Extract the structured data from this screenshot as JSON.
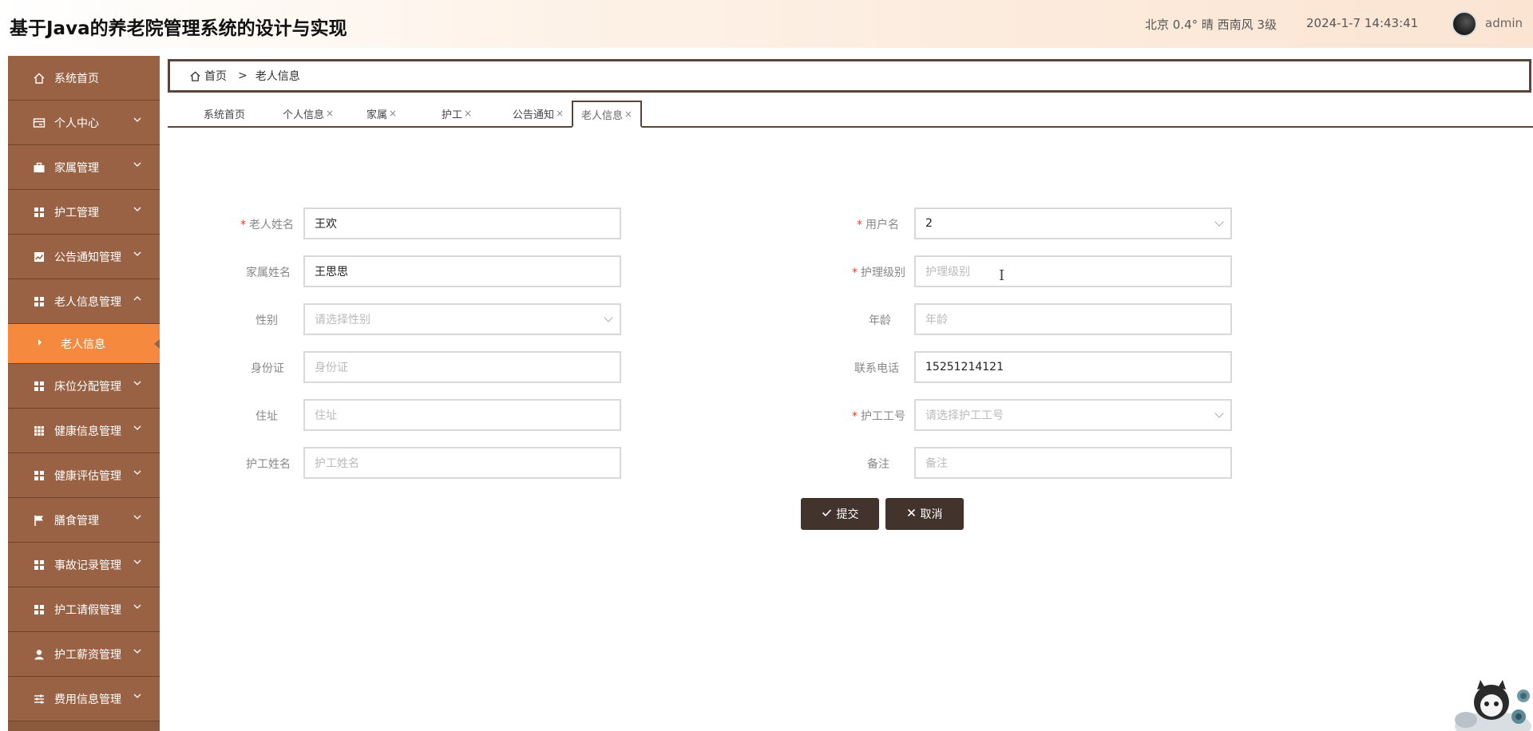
{
  "header": {
    "title": "基于Java的养老院管理系统的设计与实现",
    "weather": "北京  0.4°  晴  西南风  3级",
    "datetime": "2024-1-7 14:43:41",
    "username": "admin"
  },
  "sidebar": {
    "items": [
      {
        "label": "系统首页",
        "icon": "home-icon"
      },
      {
        "label": "个人中心",
        "icon": "card-icon"
      },
      {
        "label": "家属管理",
        "icon": "briefcase-icon"
      },
      {
        "label": "护工管理",
        "icon": "grid-icon"
      },
      {
        "label": "公告通知管理",
        "icon": "chart-icon"
      },
      {
        "label": "老人信息管理",
        "icon": "grid-icon"
      },
      {
        "label": "床位分配管理",
        "icon": "grid-icon"
      },
      {
        "label": "健康信息管理",
        "icon": "table-icon"
      },
      {
        "label": "健康评估管理",
        "icon": "grid-icon"
      },
      {
        "label": "膳食管理",
        "icon": "flag-icon"
      },
      {
        "label": "事故记录管理",
        "icon": "grid-icon"
      },
      {
        "label": "护工请假管理",
        "icon": "grid-icon"
      },
      {
        "label": "护工薪资管理",
        "icon": "user-icon"
      },
      {
        "label": "费用信息管理",
        "icon": "sliders-icon"
      }
    ],
    "active_sub": "老人信息"
  },
  "breadcrumb": {
    "home": "首页",
    "separator": ">",
    "current": "老人信息"
  },
  "tabs": [
    {
      "label": "系统首页",
      "closable": false
    },
    {
      "label": "个人信息",
      "closable": true
    },
    {
      "label": "家属",
      "closable": true
    },
    {
      "label": "护工",
      "closable": true
    },
    {
      "label": "公告通知",
      "closable": true
    },
    {
      "label": "老人信息",
      "closable": true,
      "active": true
    }
  ],
  "tab_close_glyph": "×",
  "form": {
    "required_mark": "*",
    "left": [
      {
        "label": "老人姓名",
        "required": true,
        "value": "王欢",
        "placeholder": ""
      },
      {
        "label": "家属姓名",
        "required": false,
        "value": "王思思",
        "placeholder": ""
      },
      {
        "label": "性别",
        "required": false,
        "value": "",
        "placeholder": "请选择性别",
        "dropdown": true
      },
      {
        "label": "身份证",
        "required": false,
        "value": "",
        "placeholder": "身份证"
      },
      {
        "label": "住址",
        "required": false,
        "value": "",
        "placeholder": "住址"
      },
      {
        "label": "护工姓名",
        "required": false,
        "value": "",
        "placeholder": "护工姓名"
      }
    ],
    "right": [
      {
        "label": "用户名",
        "required": true,
        "value": "2",
        "placeholder": "",
        "dropdown": true
      },
      {
        "label": "护理级别",
        "required": true,
        "value": "",
        "placeholder": "护理级别"
      },
      {
        "label": "年龄",
        "required": false,
        "value": "",
        "placeholder": "年龄"
      },
      {
        "label": "联系电话",
        "required": false,
        "value": "15251214121",
        "placeholder": ""
      },
      {
        "label": "护工工号",
        "required": true,
        "value": "",
        "placeholder": "请选择护工工号",
        "dropdown": true
      },
      {
        "label": "备注",
        "required": false,
        "value": "",
        "placeholder": "备注"
      }
    ],
    "submit_label": "提交",
    "cancel_label": "取消"
  },
  "colors": {
    "sidebar_bg": "#9a6244",
    "sidebar_active": "#f58a3f",
    "button_bg": "#42342c",
    "required": "#e8452c",
    "border_dark": "#5b4538"
  }
}
